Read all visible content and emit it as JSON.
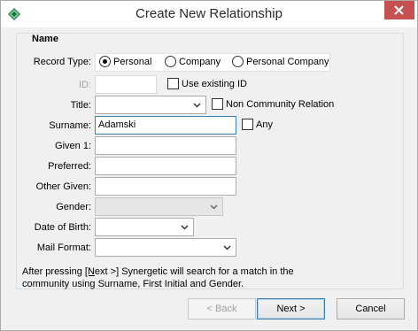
{
  "window": {
    "title": "Create New Relationship",
    "icon": "synergetic-app-icon",
    "close_icon": "close-icon",
    "close_color": "#c75050"
  },
  "group": {
    "title": "Name"
  },
  "record_type": {
    "label": "Record Type:",
    "options": [
      "Personal",
      "Company",
      "Personal Company"
    ],
    "selected": "Personal"
  },
  "id_field": {
    "label": "ID:",
    "value": "",
    "use_existing_label": "Use existing ID",
    "use_existing_checked": false
  },
  "title_field": {
    "label": "Title:",
    "value": "",
    "non_community_label": "Non Community Relation",
    "non_community_checked": false
  },
  "surname": {
    "label": "Surname:",
    "value": "Adamski",
    "any_label": "Any",
    "any_checked": false
  },
  "given1": {
    "label": "Given 1:",
    "value": ""
  },
  "preferred": {
    "label": "Preferred:",
    "value": ""
  },
  "other_given": {
    "label": "Other Given:",
    "value": ""
  },
  "gender": {
    "label": "Gender:",
    "value": ""
  },
  "dob": {
    "label": "Date of Birth:",
    "value": ""
  },
  "mail_format": {
    "label": "Mail Format:",
    "value": ""
  },
  "info": {
    "before": "After pressing ",
    "underlined": "[N",
    "after": "ext >] Synergetic will search for a match in the",
    "line2": "community using Surname, First Initial and Gender."
  },
  "buttons": {
    "back": "< Back",
    "next": "Next >",
    "cancel": "Cancel"
  }
}
